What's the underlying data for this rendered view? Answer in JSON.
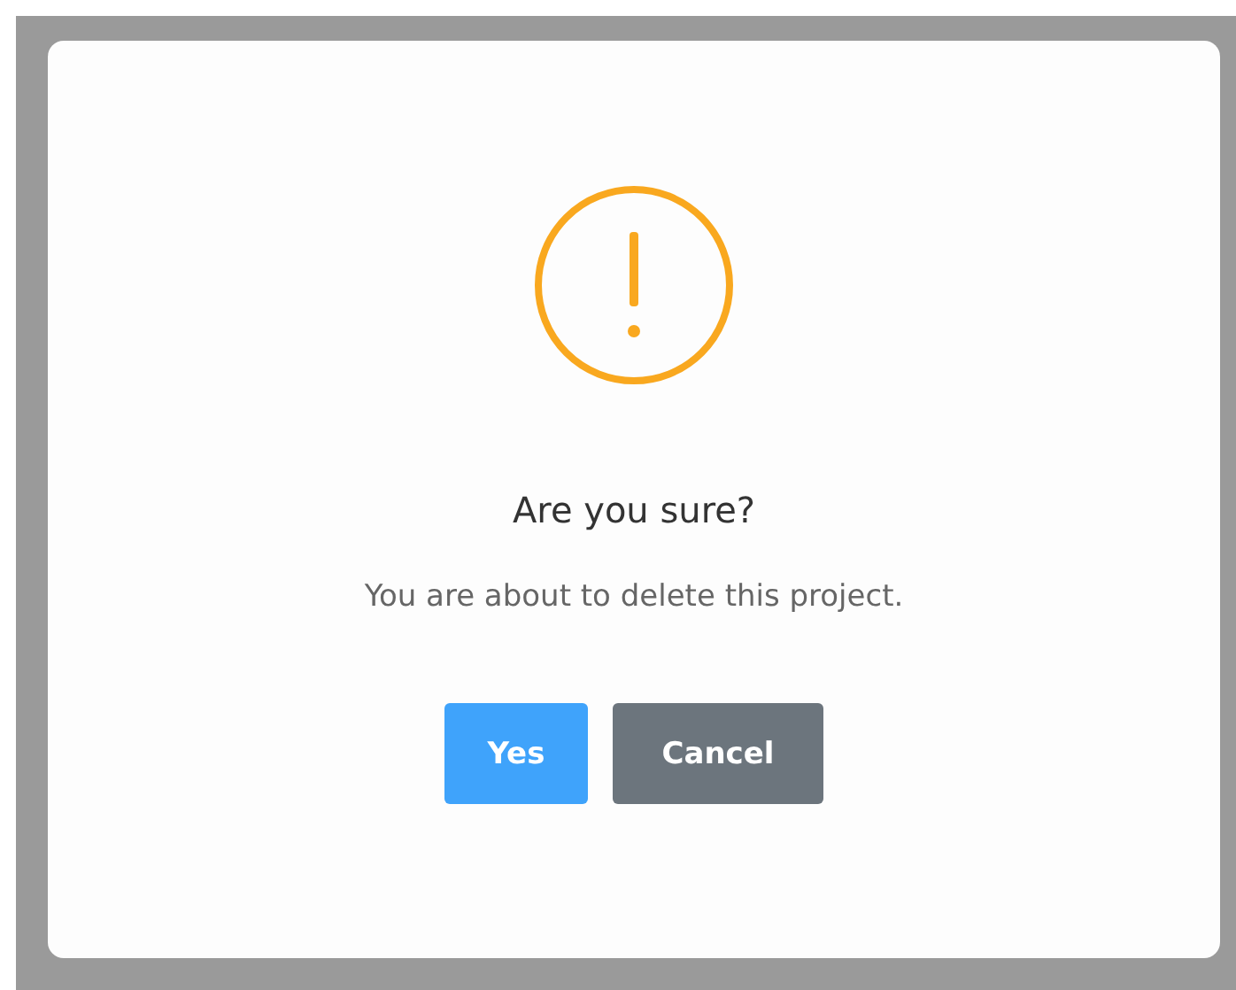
{
  "dialog": {
    "title": "Are you sure?",
    "message": "You are about to delete this project.",
    "buttons": [
      {
        "label": "Yes",
        "kind": "confirm"
      },
      {
        "label": "Cancel",
        "kind": "cancel"
      }
    ]
  }
}
